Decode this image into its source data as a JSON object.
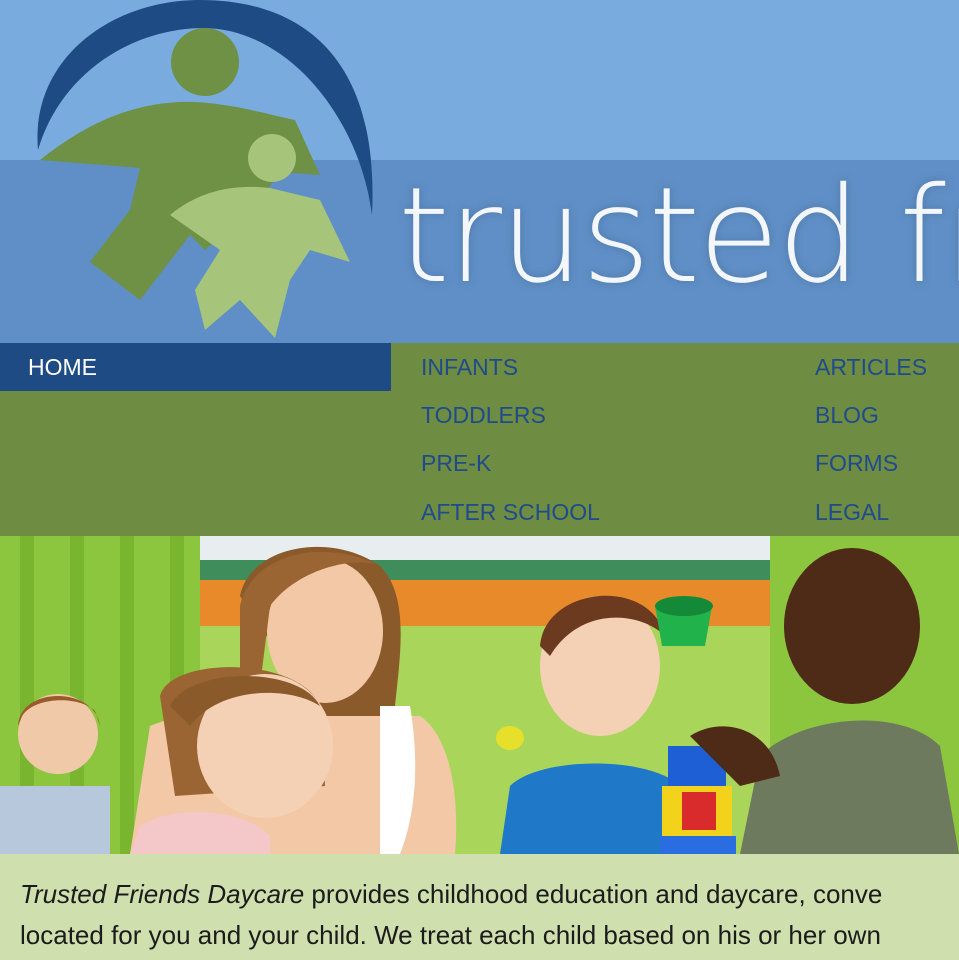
{
  "header": {
    "brand_text": "trusted fri",
    "logo_icon": "trusted-friends-logo-icon",
    "colors": {
      "sky": "#7aabdf",
      "band": "#5f8fc6",
      "arc": "#1f4b84",
      "figure_dark": "#6e9145",
      "figure_light": "#a6c47a"
    }
  },
  "nav": {
    "home": "HOME",
    "col1": [
      "INFANTS",
      "TODDLERS",
      "PRE-K",
      "AFTER SCHOOL"
    ],
    "col2": [
      "ARTICLES",
      "BLOG",
      "FORMS",
      "LEGAL"
    ],
    "colors": {
      "bar": "#6e8c42",
      "active": "#1f4b84",
      "link": "#1f4b8c"
    }
  },
  "hero": {
    "image": "children-playing-with-teacher-photo"
  },
  "intro": {
    "brand_name": "Trusted Friends Daycare",
    "line1_rest": " provides childhood education and daycare, conve",
    "line2": "located for you and your child. We treat each child based on his or her own"
  }
}
